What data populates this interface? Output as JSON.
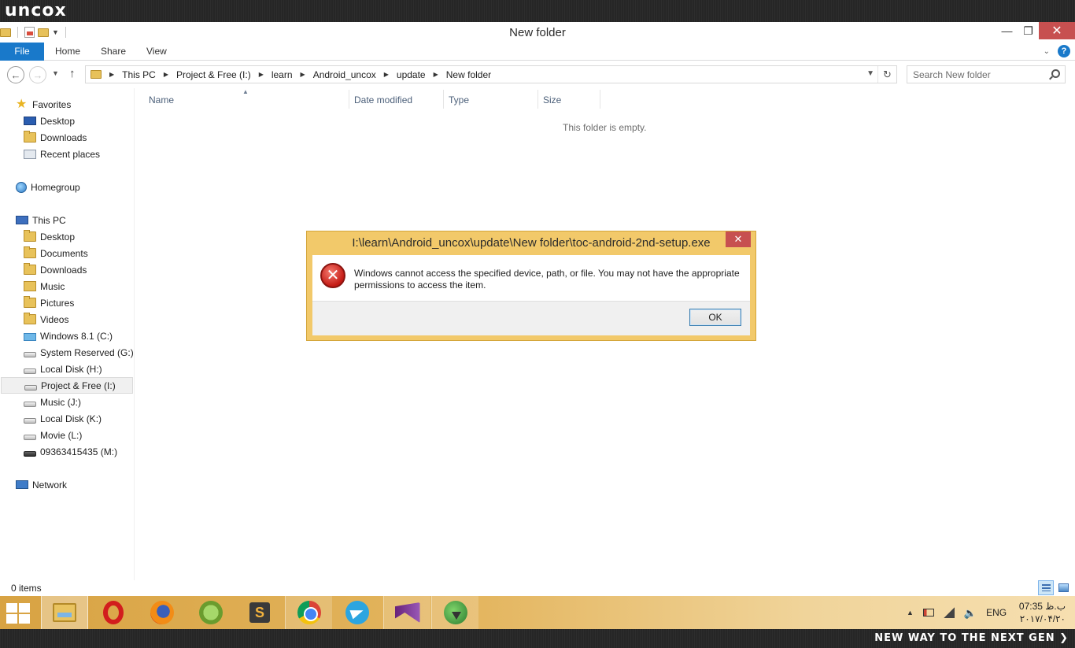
{
  "brand": {
    "logo": "uncox",
    "tagline": "NEW WAY TO THE NEXT GEN ❯"
  },
  "window": {
    "title": "New folder",
    "minimize": "—",
    "restore": "❐",
    "close": "✕"
  },
  "ribbon": {
    "tabs": [
      "File",
      "Home",
      "Share",
      "View"
    ],
    "help": "?"
  },
  "address": {
    "breadcrumbs": [
      "This PC",
      "Project & Free (I:)",
      "learn",
      "Android_uncox",
      "update",
      "New folder"
    ],
    "search_placeholder": "Search New folder"
  },
  "nav": {
    "favorites": "Favorites",
    "favorites_items": [
      "Desktop",
      "Downloads",
      "Recent places"
    ],
    "homegroup": "Homegroup",
    "thispc": "This PC",
    "thispc_items": [
      "Desktop",
      "Documents",
      "Downloads",
      "Music",
      "Pictures",
      "Videos",
      "Windows 8.1 (C:)",
      "System Reserved (G:)",
      "Local Disk (H:)",
      "Project & Free (I:)",
      "Music (J:)",
      "Local Disk (K:)",
      "Movie (L:)",
      "09363415435 (M:)"
    ],
    "network": "Network",
    "selected": "Project & Free (I:)"
  },
  "columns": [
    "Name",
    "Date modified",
    "Type",
    "Size"
  ],
  "content": {
    "empty_message": "This folder is empty."
  },
  "status": {
    "items": "0 items"
  },
  "dialog": {
    "title": "I:\\learn\\Android_uncox\\update\\New folder\\toc-android-2nd-setup.exe",
    "close": "✕",
    "message": "Windows cannot access the specified device, path, or file. You may not have the appropriate permissions to access the item.",
    "ok": "OK"
  },
  "taskbar": {
    "apps": [
      "explorer-icon",
      "opera-icon",
      "firefox-icon",
      "android-studio-icon",
      "sublime-text-icon",
      "chrome-icon",
      "telegram-icon",
      "visual-studio-icon",
      "idm-icon"
    ],
    "sublime_glyph": "S",
    "lang": "ENG",
    "time": "07:35 ب.ظ",
    "date": "۲۰۱۷/۰۴/۲۰"
  },
  "colors": {
    "accent": "#1979ca",
    "dialog_frame": "#f2c96a",
    "close_red": "#c75050",
    "taskbar": "#e4b660"
  }
}
